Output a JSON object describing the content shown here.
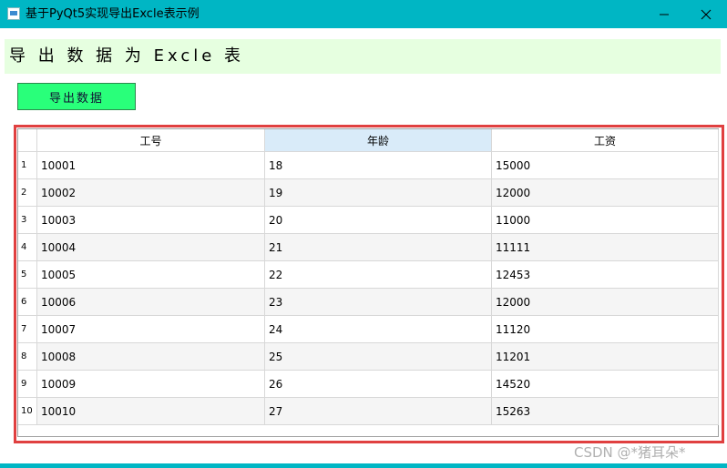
{
  "window": {
    "title": "基于PyQt5实现导出Excle表示例"
  },
  "header": {
    "text": "导 出 数 据 为 Excle 表"
  },
  "export_button": {
    "label": "导出数据"
  },
  "table": {
    "columns": [
      "工号",
      "年龄",
      "工资"
    ],
    "selected_column": 1,
    "row_numbers": [
      "1",
      "2",
      "3",
      "4",
      "5",
      "6",
      "7",
      "8",
      "9",
      "10"
    ],
    "rows": [
      [
        "10001",
        "18",
        "15000"
      ],
      [
        "10002",
        "19",
        "12000"
      ],
      [
        "10003",
        "20",
        "11000"
      ],
      [
        "10004",
        "21",
        "11111"
      ],
      [
        "10005",
        "22",
        "12453"
      ],
      [
        "10006",
        "23",
        "12000"
      ],
      [
        "10007",
        "24",
        "11120"
      ],
      [
        "10008",
        "25",
        "11201"
      ],
      [
        "10009",
        "26",
        "14520"
      ],
      [
        "10010",
        "27",
        "15263"
      ]
    ]
  },
  "watermark": {
    "text": "CSDN @*猪耳朵*"
  },
  "colors": {
    "titlebar": "#00b6c4",
    "header_band": "#e6ffe0",
    "button": "#29ff7a",
    "highlight_frame": "#e04040"
  },
  "icons": [
    "app-icon",
    "minimize-icon",
    "maximize-icon",
    "close-icon"
  ]
}
